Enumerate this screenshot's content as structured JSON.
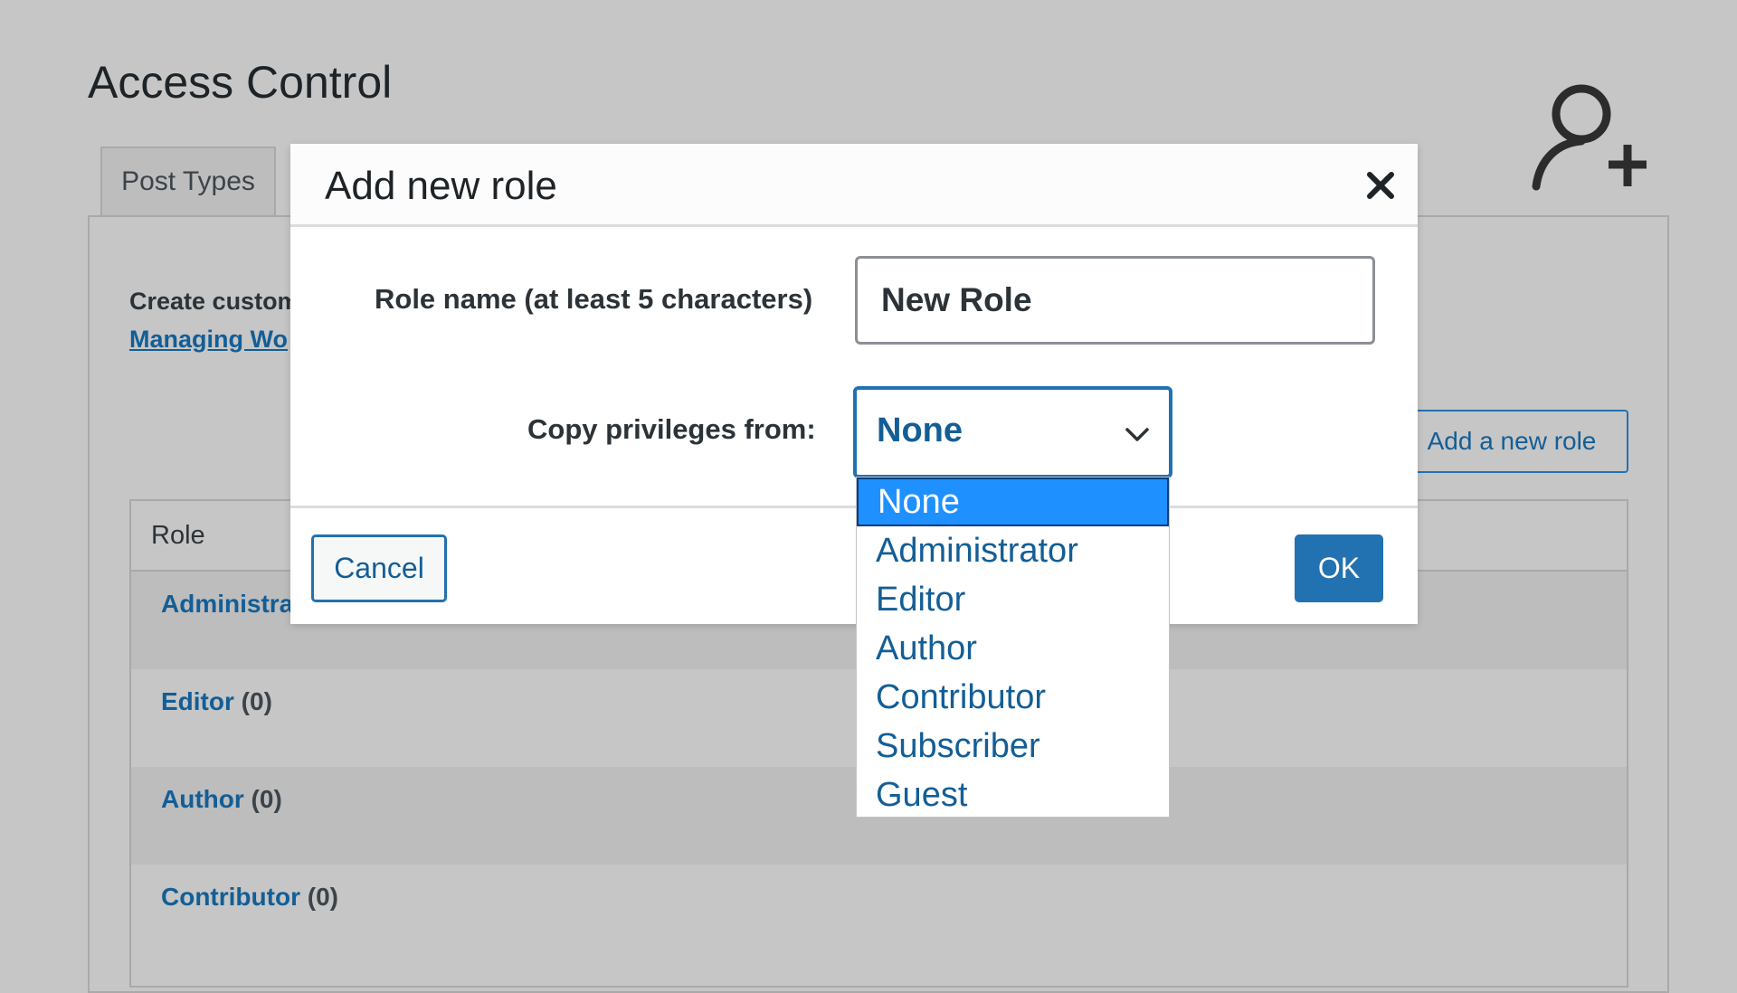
{
  "page": {
    "title": "Access Control",
    "tab_label": "Post Types",
    "intro_text": "Create custom",
    "intro_link": "Managing Wo",
    "add_role_button": "Add a new role"
  },
  "table": {
    "header_role": "Role",
    "rows": [
      {
        "name": "Administra",
        "count": ""
      },
      {
        "name": "Editor",
        "count": "(0)"
      },
      {
        "name": "Author",
        "count": "(0)"
      },
      {
        "name": "Contributor",
        "count": "(0)"
      }
    ]
  },
  "modal": {
    "title": "Add new role",
    "role_name_label": "Role name (at least 5 characters)",
    "role_name_value": "New Role",
    "copy_label": "Copy privileges from:",
    "selected_value": "None",
    "options": [
      "None",
      "Administrator",
      "Editor",
      "Author",
      "Contributor",
      "Subscriber",
      "Guest"
    ],
    "cancel_label": "Cancel",
    "ok_label": "OK"
  },
  "icons": {
    "top_right": "add-user-icon",
    "close": "close-icon",
    "dropdown": "chevron-down-icon"
  },
  "colors": {
    "accent": "#2271b1",
    "link": "#135e96",
    "highlight": "#1e90ff",
    "overlay_bg": "#c6c6c6"
  }
}
